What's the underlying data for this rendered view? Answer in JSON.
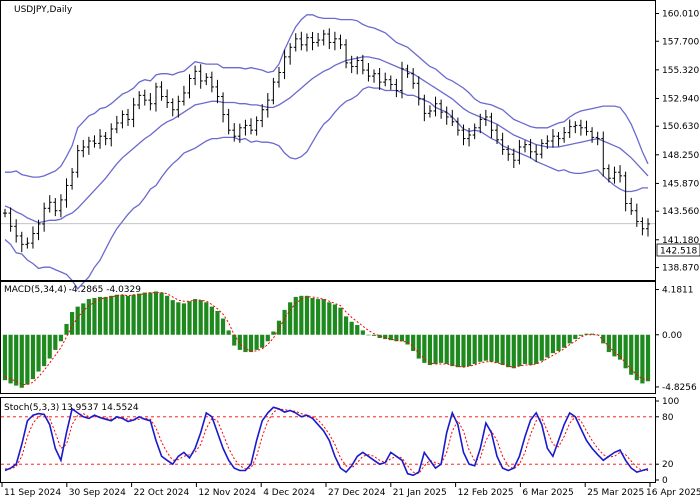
{
  "colors": {
    "background": "#ffffff",
    "axis": "#000000",
    "bollinger": "#6a6ad0",
    "macd_bar": "#1e8a1e",
    "macd_signal": "#ff0000",
    "stoch_main": "#1a1acc",
    "stoch_signal": "#ff0000",
    "price_line": "#bbbbbb"
  },
  "chart_data": [
    {
      "type": "candlestick",
      "title": "USDJPY,Daily",
      "ylim": [
        138.0,
        160.8
      ],
      "yticks": [
        "160.010",
        "157.700",
        "155.320",
        "152.940",
        "150.630",
        "148.250",
        "145.870",
        "143.560",
        "141.180",
        "138.870"
      ],
      "ytick_values": [
        160.01,
        157.7,
        155.32,
        152.94,
        150.63,
        148.25,
        145.87,
        143.56,
        141.18,
        138.87
      ],
      "last_price": "142.518",
      "last_price_value": 142.518,
      "xlabels": [
        "11 Sep 2024",
        "30 Sep 2024",
        "22 Oct 2024",
        "12 Nov 2024",
        "4 Dec 2024",
        "27 Dec 2024",
        "21 Jan 2025",
        "12 Feb 2025",
        "6 Mar 2025",
        "25 Mar 2025",
        "16 Apr 2025"
      ],
      "close": [
        143.4,
        142.3,
        141.5,
        140.8,
        140.9,
        141.7,
        142.5,
        143.8,
        144.3,
        143.6,
        144.5,
        145.7,
        146.8,
        148.6,
        148.9,
        149.4,
        149.2,
        149.8,
        149.6,
        150.4,
        150.9,
        151.6,
        151.2,
        152.4,
        153.2,
        152.8,
        152.5,
        153.9,
        153.1,
        152.6,
        152.0,
        152.7,
        153.4,
        154.6,
        155.2,
        154.4,
        154.7,
        153.9,
        153.1,
        151.6,
        150.3,
        149.8,
        150.5,
        150.7,
        150.3,
        151.1,
        152.0,
        152.8,
        154.3,
        155.1,
        156.4,
        157.2,
        157.9,
        157.4,
        158.0,
        157.6,
        157.8,
        158.3,
        157.6,
        157.9,
        157.4,
        155.9,
        155.6,
        156.1,
        155.3,
        154.8,
        155.0,
        154.3,
        154.5,
        154.1,
        153.6,
        155.4,
        155.0,
        154.2,
        152.9,
        151.7,
        151.9,
        152.5,
        151.8,
        151.4,
        151.0,
        150.3,
        149.6,
        149.9,
        150.5,
        151.2,
        151.4,
        150.3,
        149.5,
        148.7,
        148.3,
        147.8,
        148.9,
        149.1,
        148.5,
        148.3,
        149.2,
        149.4,
        149.8,
        149.6,
        150.1,
        150.6,
        150.7,
        150.5,
        150.2,
        149.7,
        149.6,
        147.1,
        146.3,
        146.8,
        146.5,
        144.2,
        143.6,
        142.7,
        142.1,
        142.5
      ],
      "bollinger": {
        "period": 20,
        "deviations": 2,
        "upper": [
          146.8,
          146.8,
          146.9,
          146.6,
          146.5,
          146.4,
          146.4,
          146.5,
          146.7,
          146.9,
          147.3,
          148.1,
          149.0,
          150.5,
          151.0,
          151.5,
          151.7,
          152.1,
          152.2,
          152.5,
          152.9,
          153.3,
          153.5,
          153.8,
          154.3,
          154.5,
          154.4,
          154.9,
          155.0,
          155.0,
          154.9,
          155.1,
          155.2,
          155.6,
          156.0,
          155.9,
          155.8,
          155.8,
          155.8,
          155.5,
          155.5,
          155.5,
          155.5,
          155.4,
          155.5,
          155.4,
          155.3,
          155.1,
          155.2,
          155.8,
          157.0,
          158.0,
          158.9,
          159.5,
          159.9,
          159.9,
          159.7,
          159.6,
          159.6,
          159.6,
          159.5,
          159.5,
          159.5,
          159.4,
          159.1,
          158.9,
          158.8,
          158.6,
          158.4,
          158.0,
          157.6,
          157.4,
          157.2,
          156.8,
          156.4,
          156.0,
          155.6,
          155.4,
          155.0,
          154.6,
          154.4,
          154.1,
          153.8,
          153.4,
          152.9,
          152.6,
          152.5,
          152.4,
          152.2,
          152.0,
          151.6,
          151.2,
          151.0,
          150.8,
          150.6,
          150.5,
          150.5,
          150.5,
          150.7,
          150.9,
          151.0,
          151.4,
          151.7,
          151.9,
          152.0,
          152.1,
          152.2,
          152.3,
          152.3,
          152.3,
          152.2,
          151.6,
          150.8,
          149.7,
          148.5,
          147.5
        ],
        "middle": [
          144.0,
          143.8,
          143.5,
          143.3,
          143.0,
          142.8,
          142.6,
          142.7,
          142.8,
          142.8,
          142.9,
          143.2,
          143.4,
          143.8,
          144.3,
          144.8,
          145.3,
          145.8,
          146.3,
          146.9,
          147.5,
          148.0,
          148.4,
          148.8,
          149.2,
          149.6,
          149.9,
          150.3,
          150.7,
          151.0,
          151.2,
          151.5,
          151.8,
          152.1,
          152.4,
          152.5,
          152.6,
          152.7,
          152.7,
          152.6,
          152.6,
          152.6,
          152.5,
          152.5,
          152.4,
          152.4,
          152.3,
          152.2,
          152.2,
          152.4,
          152.7,
          153.0,
          153.4,
          153.8,
          154.2,
          154.6,
          154.9,
          155.2,
          155.4,
          155.7,
          155.9,
          156.1,
          156.2,
          156.3,
          156.4,
          156.4,
          156.3,
          156.2,
          156.0,
          155.8,
          155.6,
          155.4,
          155.2,
          155.0,
          154.7,
          154.4,
          154.1,
          153.8,
          153.5,
          153.2,
          152.9,
          152.5,
          152.1,
          151.8,
          151.6,
          151.4,
          151.2,
          151.0,
          150.8,
          150.5,
          150.2,
          149.9,
          149.7,
          149.5,
          149.3,
          149.1,
          149.0,
          148.9,
          148.9,
          148.9,
          149.0,
          149.1,
          149.2,
          149.3,
          149.4,
          149.5,
          149.6,
          149.4,
          149.2,
          149.0,
          148.8,
          148.4,
          148.0,
          147.5,
          147.0,
          146.5
        ],
        "lower": [
          141.2,
          140.8,
          140.1,
          140.0,
          139.5,
          139.2,
          138.8,
          138.9,
          138.9,
          138.7,
          138.5,
          138.3,
          137.8,
          137.1,
          137.6,
          138.1,
          138.9,
          139.5,
          140.4,
          141.3,
          142.1,
          142.7,
          143.3,
          143.8,
          144.1,
          144.7,
          145.4,
          145.7,
          146.4,
          147.0,
          147.5,
          147.9,
          148.4,
          148.6,
          148.8,
          149.1,
          149.4,
          149.6,
          149.6,
          149.7,
          149.7,
          149.7,
          149.5,
          149.6,
          149.3,
          149.4,
          149.3,
          149.3,
          149.2,
          149.0,
          148.4,
          148.0,
          147.9,
          148.1,
          148.5,
          149.3,
          150.1,
          150.8,
          151.2,
          151.8,
          152.3,
          152.7,
          152.9,
          153.2,
          153.7,
          153.9,
          153.8,
          153.8,
          153.6,
          153.6,
          153.6,
          153.4,
          153.2,
          153.2,
          153.0,
          152.8,
          152.6,
          152.2,
          152.0,
          151.8,
          151.4,
          150.9,
          150.4,
          150.2,
          150.3,
          150.2,
          149.9,
          149.6,
          149.4,
          149.0,
          148.8,
          148.6,
          148.4,
          148.2,
          148.0,
          147.7,
          147.5,
          147.3,
          147.1,
          146.9,
          147.0,
          146.8,
          146.7,
          146.7,
          146.8,
          146.9,
          147.0,
          146.5,
          146.1,
          145.7,
          145.4,
          145.2,
          145.2,
          145.3,
          145.5,
          145.5
        ]
      }
    },
    {
      "type": "bar",
      "title": "MACD(5,34,4)",
      "readout": "-4.2865 -4.0329",
      "ylim": [
        -5.2,
        4.6
      ],
      "yticks": [
        "4.1811",
        "0.00",
        "-4.8256"
      ],
      "ytick_values": [
        4.1811,
        0.0,
        -4.8256
      ],
      "histogram": [
        -4.2,
        -4.5,
        -4.7,
        -4.9,
        -4.6,
        -4.1,
        -3.4,
        -2.9,
        -2.2,
        -1.4,
        -0.6,
        1.0,
        2.1,
        2.6,
        2.9,
        3.3,
        3.4,
        3.5,
        3.5,
        3.6,
        3.7,
        3.7,
        3.6,
        3.7,
        3.8,
        3.9,
        3.9,
        4.0,
        3.9,
        3.6,
        3.2,
        3.0,
        2.9,
        3.1,
        3.3,
        3.2,
        3.0,
        2.6,
        2.2,
        1.5,
        0.4,
        -1.0,
        -1.4,
        -1.6,
        -1.6,
        -1.4,
        -1.2,
        -0.6,
        0.3,
        1.3,
        2.3,
        3.0,
        3.5,
        3.6,
        3.6,
        3.4,
        3.3,
        3.3,
        3.0,
        2.8,
        2.5,
        1.7,
        1.2,
        0.9,
        0.4,
        0.0,
        -0.1,
        -0.3,
        -0.4,
        -0.5,
        -0.6,
        -0.6,
        -0.9,
        -1.5,
        -2.2,
        -2.6,
        -2.8,
        -2.7,
        -2.6,
        -2.7,
        -2.9,
        -3.0,
        -3.0,
        -2.9,
        -2.7,
        -2.5,
        -2.4,
        -2.5,
        -2.6,
        -2.8,
        -3.0,
        -3.1,
        -2.9,
        -2.7,
        -2.8,
        -2.7,
        -2.4,
        -2.1,
        -1.7,
        -1.5,
        -1.2,
        -0.8,
        -0.4,
        -0.1,
        0.1,
        0.1,
        0.0,
        -0.8,
        -1.6,
        -2.0,
        -2.3,
        -3.1,
        -3.7,
        -4.2,
        -4.5,
        -4.3
      ],
      "signal": [
        -3.9,
        -4.1,
        -4.3,
        -4.6,
        -4.6,
        -4.4,
        -3.9,
        -3.3,
        -2.6,
        -1.9,
        -1.2,
        -0.2,
        0.8,
        1.6,
        2.2,
        2.7,
        3.0,
        3.3,
        3.4,
        3.5,
        3.6,
        3.7,
        3.6,
        3.7,
        3.7,
        3.8,
        3.9,
        3.9,
        3.9,
        3.8,
        3.5,
        3.2,
        3.1,
        3.1,
        3.2,
        3.2,
        3.1,
        2.8,
        2.4,
        1.9,
        1.1,
        0.0,
        -0.8,
        -1.3,
        -1.5,
        -1.5,
        -1.3,
        -0.9,
        -0.3,
        0.6,
        1.5,
        2.3,
        2.9,
        3.3,
        3.5,
        3.5,
        3.4,
        3.3,
        3.1,
        2.9,
        2.7,
        2.1,
        1.6,
        1.2,
        0.8,
        0.4,
        0.1,
        -0.1,
        -0.3,
        -0.4,
        -0.5,
        -0.6,
        -0.7,
        -1.1,
        -1.7,
        -2.2,
        -2.6,
        -2.7,
        -2.7,
        -2.7,
        -2.8,
        -2.9,
        -3.0,
        -2.9,
        -2.8,
        -2.6,
        -2.5,
        -2.5,
        -2.6,
        -2.7,
        -2.9,
        -3.0,
        -2.9,
        -2.8,
        -2.8,
        -2.7,
        -2.5,
        -2.2,
        -1.9,
        -1.6,
        -1.3,
        -0.9,
        -0.6,
        -0.2,
        0.0,
        0.0,
        0.0,
        -0.5,
        -1.1,
        -1.6,
        -2.0,
        -2.6,
        -3.2,
        -3.7,
        -4.1,
        -4.1
      ]
    },
    {
      "type": "line",
      "title": "Stoch(5,3,3)",
      "readout": "13.9537 14.5524",
      "ylim": [
        0,
        100
      ],
      "yticks": [
        "100",
        "80",
        "20",
        "0"
      ],
      "ytick_values": [
        100,
        80,
        20,
        0
      ],
      "levels": [
        80,
        20
      ],
      "series": [
        {
          "values": [
            12,
            15,
            20,
            45,
            75,
            82,
            84,
            83,
            70,
            40,
            25,
            60,
            90,
            85,
            80,
            78,
            82,
            79,
            77,
            75,
            80,
            78,
            74,
            76,
            80,
            77,
            75,
            50,
            30,
            25,
            20,
            30,
            35,
            28,
            40,
            60,
            85,
            80,
            60,
            40,
            25,
            15,
            12,
            12,
            20,
            50,
            75,
            85,
            92,
            90,
            86,
            88,
            85,
            80,
            82,
            78,
            70,
            62,
            50,
            30,
            15,
            10,
            18,
            30,
            35,
            30,
            25,
            20,
            22,
            35,
            30,
            25,
            8,
            6,
            10,
            35,
            25,
            15,
            20,
            60,
            85,
            70,
            35,
            20,
            18,
            40,
            72,
            60,
            30,
            15,
            12,
            15,
            30,
            55,
            76,
            85,
            70,
            40,
            30,
            50,
            70,
            85,
            80,
            65,
            50,
            40,
            32,
            25,
            30,
            35,
            38,
            25,
            15,
            10,
            12,
            14
          ]
        },
        {
          "values": [
            14,
            14,
            17,
            30,
            55,
            72,
            80,
            83,
            78,
            60,
            40,
            45,
            70,
            82,
            84,
            80,
            80,
            80,
            79,
            77,
            78,
            79,
            77,
            76,
            77,
            78,
            77,
            66,
            48,
            35,
            25,
            26,
            30,
            32,
            35,
            45,
            65,
            78,
            75,
            58,
            40,
            27,
            18,
            14,
            15,
            30,
            55,
            74,
            86,
            90,
            89,
            88,
            87,
            84,
            82,
            80,
            76,
            68,
            58,
            45,
            28,
            18,
            15,
            22,
            30,
            32,
            30,
            25,
            22,
            27,
            30,
            28,
            18,
            10,
            8,
            18,
            25,
            22,
            20,
            35,
            62,
            75,
            62,
            38,
            24,
            28,
            50,
            62,
            50,
            30,
            18,
            14,
            20,
            35,
            58,
            75,
            78,
            62,
            45,
            42,
            55,
            72,
            80,
            75,
            62,
            50,
            40,
            32,
            29,
            30,
            35,
            32,
            24,
            16,
            12,
            12
          ]
        }
      ]
    }
  ]
}
